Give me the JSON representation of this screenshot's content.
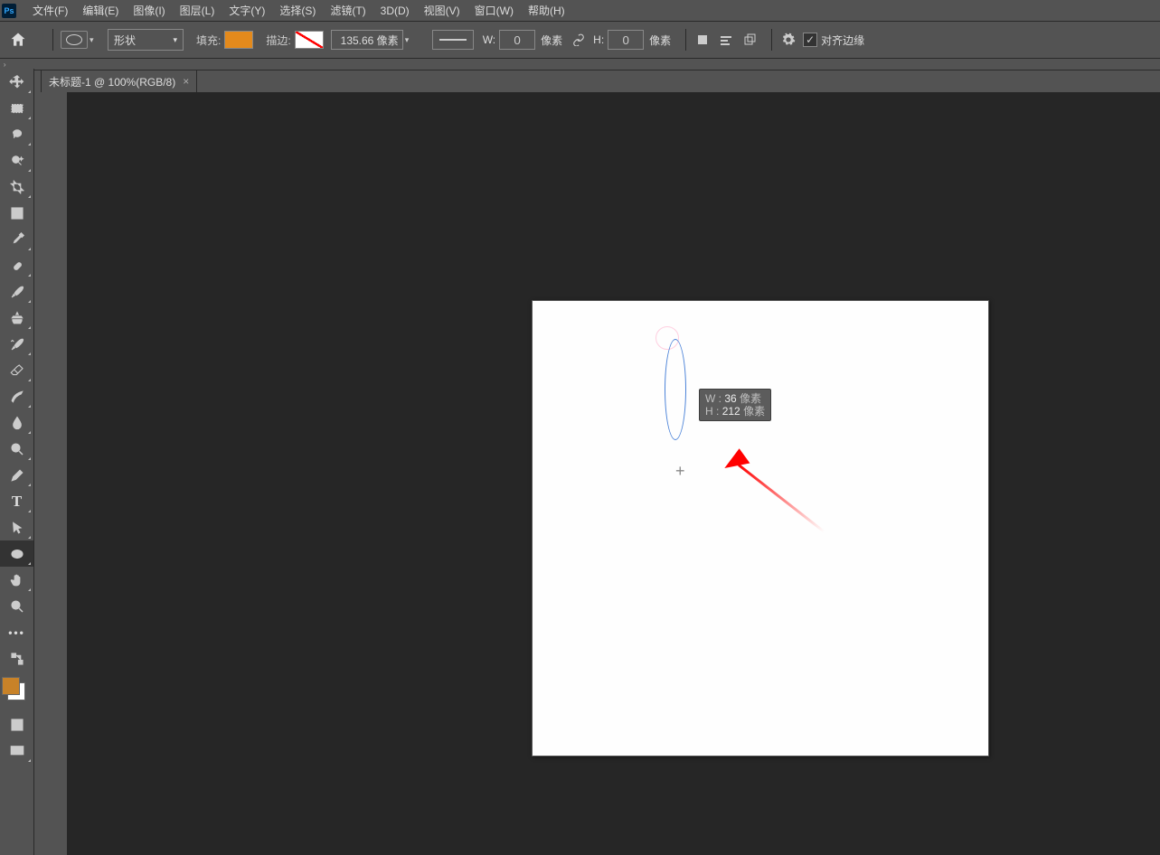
{
  "menu": {
    "file": "文件(F)",
    "edit": "编辑(E)",
    "image": "图像(I)",
    "layer": "图层(L)",
    "text": "文字(Y)",
    "select": "选择(S)",
    "filter": "滤镜(T)",
    "threeD": "3D(D)",
    "view": "视图(V)",
    "window": "窗口(W)",
    "help": "帮助(H)"
  },
  "options": {
    "mode": "形状",
    "fill_label": "填充:",
    "stroke_label": "描边:",
    "stroke_width": "135.66 像素",
    "w_label": "W:",
    "w_value": "0",
    "w_unit": "像素",
    "h_label": "H:",
    "h_value": "0",
    "h_unit": "像素",
    "align_edges": "对齐边缘",
    "fill_color": "#E48A1C"
  },
  "document": {
    "tab_title": "未标题-1 @ 100%(RGB/8)"
  },
  "canvas": {
    "tooltip_w_label": "W :",
    "tooltip_w_value": "36",
    "tooltip_w_unit": "像素",
    "tooltip_h_label": "H :",
    "tooltip_h_value": "212",
    "tooltip_h_unit": "像素"
  },
  "tools": {
    "move": "move-tool",
    "marquee": "rectangular-marquee-tool",
    "lasso": "lasso-tool",
    "magicwand": "quick-selection-tool",
    "crop": "crop-tool",
    "frame": "frame-tool",
    "eyedropper": "eyedropper-tool",
    "healing": "spot-healing-tool",
    "brush": "brush-tool",
    "stamp": "clone-stamp-tool",
    "history": "history-brush-tool",
    "eraser": "eraser-tool",
    "gradient": "gradient-tool",
    "blur": "blur-tool",
    "dodge": "dodge-tool",
    "pen": "pen-tool",
    "type": "type-tool",
    "path": "path-selection-tool",
    "shape": "ellipse-tool",
    "hand": "hand-tool",
    "zoom": "zoom-tool"
  }
}
